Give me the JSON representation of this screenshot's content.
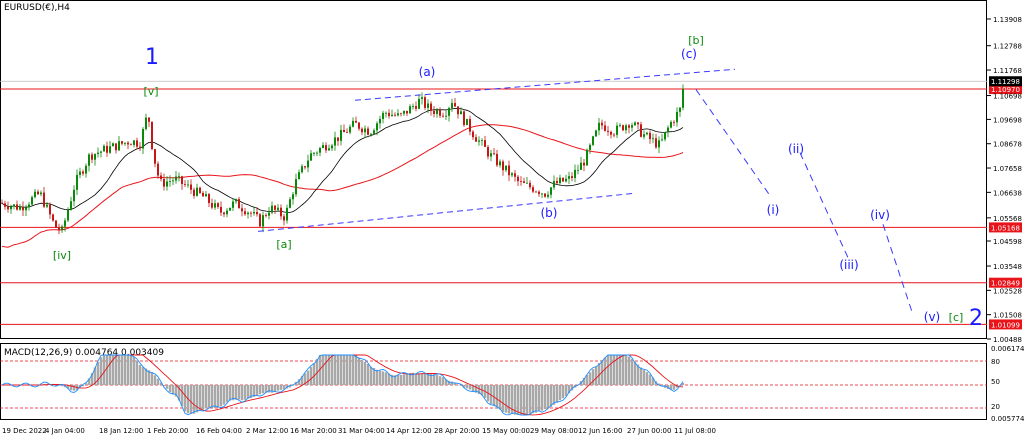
{
  "title": "EURUSD(€),H4",
  "macd_title": "MACD(12,26,9) 0.004764 0.003409",
  "chart_data": {
    "type": "candlestick",
    "symbol": "EURUSD",
    "timeframe": "H4",
    "ylim": [
      1.00488,
      1.13908
    ],
    "price_ticks": [
      1.13908,
      1.12788,
      1.11768,
      1.10698,
      1.09698,
      1.08678,
      1.07658,
      1.06638,
      1.05568,
      1.04598,
      1.03548,
      1.02528,
      1.01508,
      1.00488
    ],
    "x_labels": [
      "19 Dec 2022",
      "4 Jan 04:00",
      "18 Jan 12:00",
      "1 Feb 20:00",
      "16 Feb 04:00",
      "2 Mar 12:00",
      "16 Mar 20:00",
      "31 Mar 04:00",
      "14 Apr 12:00",
      "28 Apr 20:00",
      "15 May 00:00",
      "29 May 08:00",
      "12 Jun 16:00",
      "27 Jun 00:00",
      "11 Jul 08:00"
    ],
    "current_price": "1.11298",
    "horizontal_levels": [
      {
        "value": 1.1097,
        "label": "1.10970",
        "color": "#e8141a"
      },
      {
        "value": 1.05168,
        "label": "1.05168",
        "color": "#e8141a"
      },
      {
        "value": 1.02849,
        "label": "1.02849",
        "color": "#e8141a"
      },
      {
        "value": 1.01099,
        "label": "1.01099",
        "color": "#e8141a"
      }
    ],
    "price_path": [
      [
        0,
        1.062
      ],
      [
        20,
        1.06
      ],
      [
        40,
        1.066
      ],
      [
        55,
        1.052
      ],
      [
        62,
        1.05
      ],
      [
        75,
        1.07
      ],
      [
        90,
        1.082
      ],
      [
        110,
        1.085
      ],
      [
        130,
        1.088
      ],
      [
        140,
        1.087
      ],
      [
        148,
        1.1
      ],
      [
        153,
        1.083
      ],
      [
        160,
        1.07
      ],
      [
        175,
        1.072
      ],
      [
        190,
        1.068
      ],
      [
        205,
        1.064
      ],
      [
        220,
        1.058
      ],
      [
        235,
        1.062
      ],
      [
        250,
        1.058
      ],
      [
        260,
        1.054
      ],
      [
        270,
        1.06
      ],
      [
        285,
        1.056
      ],
      [
        295,
        1.07
      ],
      [
        310,
        1.082
      ],
      [
        325,
        1.086
      ],
      [
        340,
        1.09
      ],
      [
        355,
        1.095
      ],
      [
        370,
        1.092
      ],
      [
        385,
        1.1
      ],
      [
        400,
        1.098
      ],
      [
        420,
        1.105
      ],
      [
        430,
        1.101
      ],
      [
        445,
        1.1
      ],
      [
        452,
        1.105
      ],
      [
        462,
        1.098
      ],
      [
        475,
        1.09
      ],
      [
        490,
        1.082
      ],
      [
        505,
        1.076
      ],
      [
        520,
        1.07
      ],
      [
        535,
        1.068
      ],
      [
        545,
        1.066
      ],
      [
        555,
        1.07
      ],
      [
        570,
        1.072
      ],
      [
        585,
        1.08
      ],
      [
        600,
        1.095
      ],
      [
        615,
        1.092
      ],
      [
        630,
        1.096
      ],
      [
        645,
        1.09
      ],
      [
        660,
        1.086
      ],
      [
        670,
        1.095
      ],
      [
        680,
        1.101
      ],
      [
        684,
        1.1125
      ]
    ],
    "wave_labels": [
      {
        "text": "1",
        "color": "#1a1aff",
        "size": "large"
      },
      {
        "text": "[v]",
        "color": "#0a8a0a"
      },
      {
        "text": "[iv]",
        "color": "#0a8a0a"
      },
      {
        "text": "[a]",
        "color": "#0a8a0a"
      },
      {
        "text": "(a)",
        "color": "#1a1aff"
      },
      {
        "text": "(b)",
        "color": "#1a1aff"
      },
      {
        "text": "(c)",
        "color": "#1a1aff"
      },
      {
        "text": "[b]",
        "color": "#0a8a0a"
      },
      {
        "text": "(i)",
        "color": "#1a1aff"
      },
      {
        "text": "(ii)",
        "color": "#1a1aff"
      },
      {
        "text": "(iii)",
        "color": "#1a1aff"
      },
      {
        "text": "(iv)",
        "color": "#1a1aff"
      },
      {
        "text": "(v)",
        "color": "#1a1aff"
      },
      {
        "text": "[c]",
        "color": "#0a8a0a"
      },
      {
        "text": "2",
        "color": "#1a1aff",
        "size": "large"
      }
    ],
    "projection_path": [
      [
        684,
        1.1125
      ],
      [
        770,
        1.065
      ],
      [
        800,
        1.087
      ],
      [
        850,
        1.039
      ],
      [
        880,
        1.056
      ],
      [
        910,
        1.015
      ]
    ],
    "macd": {
      "ticks": [
        {
          "label": "0.006174"
        },
        {
          "label": "80"
        },
        {
          "label": "50"
        },
        {
          "label": "20"
        },
        {
          "label": "0.005774"
        }
      ],
      "levels": [
        80,
        50,
        20
      ]
    },
    "colors": {
      "bull": "#0a8a0a",
      "bear": "#c41818",
      "ma_black": "#000000",
      "ma_red": "#e8141a",
      "level_line": "#e8141a",
      "trendline": "#3a3aff",
      "projection": "#3a3aff",
      "macd_hist": "#a8a8a8",
      "macd_signal": "#e8141a",
      "macd_line": "#1e90ff"
    }
  }
}
